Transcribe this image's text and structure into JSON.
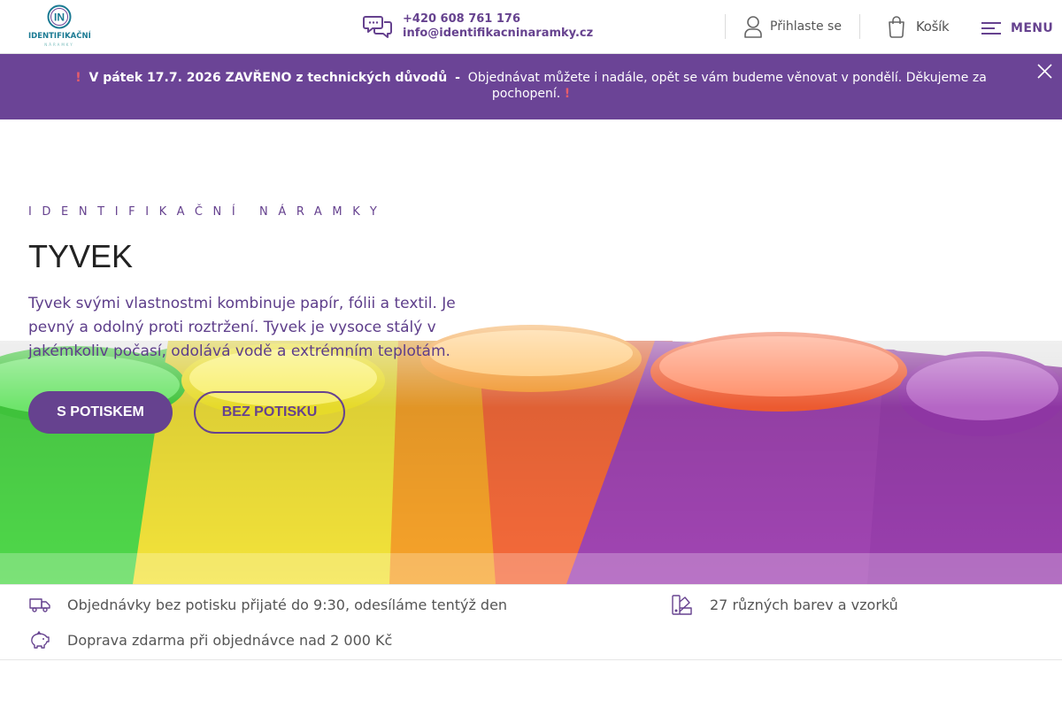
{
  "header": {
    "logo_text": "IDENTIFIKAČNÍ",
    "logo_sub": "NÁRAMKY",
    "logo_badge": "IN",
    "phone": "+420 608 761 176",
    "email": "info@identifikacninaramky.cz",
    "login_label": "Přihlaste se",
    "cart_label": "Košík",
    "menu_label": "MENU",
    "icons": {
      "contact": "chat-bubbles-icon",
      "login": "user-icon",
      "cart": "shopping-bag-icon",
      "menu": "hamburger-icon"
    }
  },
  "notice": {
    "excl": "!",
    "bold": "V pátek 17.7. 2026 ZAVŘENO z technických důvodů",
    "dash": "-",
    "text": "Objednávat můžete i nadále, opět se vám budeme věnovat v pondělí. Děkujeme za pochopení.",
    "close_icon": "close-icon",
    "accent_color": "#6b4496"
  },
  "hero": {
    "eyebrow": "IDENTIFIKAČNÍ NÁRAMKY",
    "title": "TYVEK",
    "description": "Tyvek svými vlastnostmi kombinuje papír, fólii a textil. Je pevný a odolný proti roztržení. Tyvek je vysoce stálý v jakémkoliv počasí, odolává vodě a extrémním teplotám.",
    "primary_button": "S POTISKEM",
    "secondary_button": "BEZ POTISKU",
    "brand_color": "#66428f"
  },
  "features": [
    {
      "icon": "delivery-truck-icon",
      "label": "Objednávky bez potisku přijaté do 9:30, odesíláme tentýž den"
    },
    {
      "icon": "color-swatches-icon",
      "label": "27 různých barev a vzorků"
    },
    {
      "icon": "piggy-bank-icon",
      "label": "Doprava zdarma při objednávce nad 2 000 Kč"
    }
  ]
}
